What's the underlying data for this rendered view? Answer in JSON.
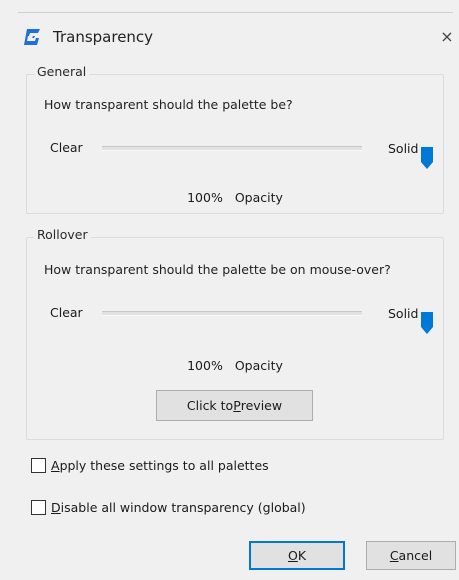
{
  "window": {
    "title": "Transparency",
    "app_icon": "gstarcad-g-icon",
    "close_glyph": "×",
    "accent_color": "#1e6fd9"
  },
  "general": {
    "group_label": "General",
    "question": "How transparent should the palette be?",
    "clear_label": "Clear",
    "solid_label": "Solid",
    "opacity_value": "100%",
    "opacity_label": "Opacity",
    "slider_level": 1.0
  },
  "rollover": {
    "group_label": "Rollover",
    "question": "How transparent should the palette be on mouse-over?",
    "clear_label": "Clear",
    "solid_label": "Solid",
    "opacity_value": "100%",
    "opacity_label": "Opacity",
    "slider_level": 1.0,
    "preview_button": {
      "first": "Click to ",
      "accel": "P",
      "rest": "review"
    }
  },
  "options": {
    "apply_all": {
      "accel": "A",
      "rest": "pply these settings to all palettes",
      "checked": false
    },
    "disable_global": {
      "accel": "D",
      "rest": "isable all window transparency (global)",
      "checked": false
    }
  },
  "buttons": {
    "ok": {
      "accel": "O",
      "rest": "K"
    },
    "cancel": {
      "accel": "C",
      "rest": "ancel"
    }
  }
}
